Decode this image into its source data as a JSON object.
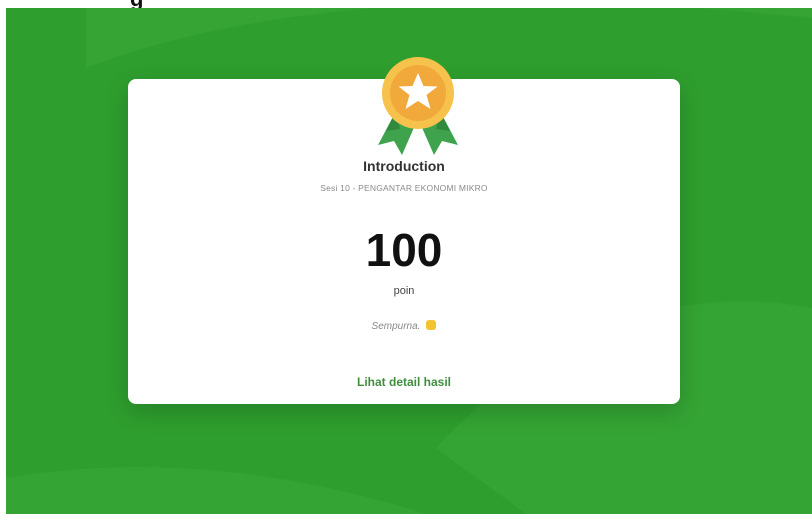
{
  "page": {
    "header_fragment": "g"
  },
  "result": {
    "title": "Introduction",
    "subtitle": "Sesi 10 - PENGANTAR EKONOMI MIKRO",
    "score": "100",
    "score_unit": "poin",
    "feedback": "Sempurna.",
    "detail_link": "Lihat detail hasil"
  },
  "colors": {
    "background": "#2e9e2e",
    "medal_gold": "#f2b230",
    "ribbon": "#3fa34d",
    "link": "#3e8f3e"
  },
  "icons": {
    "medal": "medal-star-icon",
    "feedback_emoji": "clap-emoji-icon"
  }
}
